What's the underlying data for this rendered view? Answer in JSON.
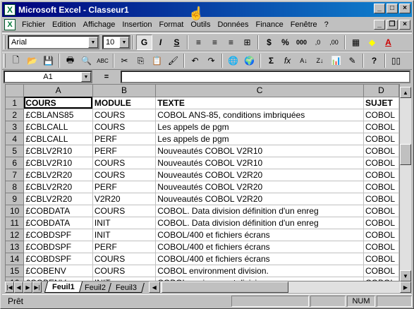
{
  "title": "Microsoft Excel - Classeur1",
  "menu": [
    "Fichier",
    "Edition",
    "Affichage",
    "Insertion",
    "Format",
    "Outils",
    "Données",
    "Finance",
    "Fenêtre",
    "?"
  ],
  "font": {
    "name": "Arial",
    "size": "10"
  },
  "namebox": "A1",
  "formula_eq": "=",
  "columns": [
    "A",
    "B",
    "C",
    "D"
  ],
  "rows": [
    [
      "COURS",
      "MODULE",
      "TEXTE",
      "SUJET"
    ],
    [
      "£CBLANS85",
      "COURS",
      "COBOL ANS-85, conditions imbriquées",
      "COBOL"
    ],
    [
      "£CBLCALL",
      "COURS",
      "Les appels de pgm",
      "COBOL"
    ],
    [
      "£CBLCALL",
      "PERF",
      "Les appels de pgm",
      "COBOL"
    ],
    [
      "£CBLV2R10",
      "PERF",
      "Nouveautés COBOL V2R10",
      "COBOL"
    ],
    [
      "£CBLV2R10",
      "COURS",
      "Nouveautés COBOL V2R10",
      "COBOL"
    ],
    [
      "£CBLV2R20",
      "COURS",
      "Nouveautés COBOL V2R20",
      "COBOL"
    ],
    [
      "£CBLV2R20",
      "PERF",
      "Nouveautés COBOL V2R20",
      "COBOL"
    ],
    [
      "£CBLV2R20",
      "V2R20",
      "Nouveautés COBOL V2R20",
      "COBOL"
    ],
    [
      "£COBDATA",
      "COURS",
      "COBOL. Data division définition d'un enreg",
      "COBOL"
    ],
    [
      "£COBDATA",
      "INIT",
      "COBOL. Data division définition d'un enreg",
      "COBOL"
    ],
    [
      "£COBDSPF",
      "INIT",
      "COBOL/400 et fichiers écrans",
      "COBOL"
    ],
    [
      "£COBDSPF",
      "PERF",
      "COBOL/400 et fichiers écrans",
      "COBOL"
    ],
    [
      "£COBDSPF",
      "COURS",
      "COBOL/400 et fichiers écrans",
      "COBOL"
    ],
    [
      "£COBENV",
      "COURS",
      "COBOL environment division.",
      "COBOL"
    ],
    [
      "£COBENV",
      "INIT",
      "COBOL environment division.",
      "COBOL"
    ]
  ],
  "sheets": [
    "Feuil1",
    "Feuil2",
    "Feuil3"
  ],
  "status": "Prêt",
  "num": "NUM",
  "toolbar_font_buttons": {
    "bold": "G",
    "italic": "I",
    "underline": "S"
  }
}
